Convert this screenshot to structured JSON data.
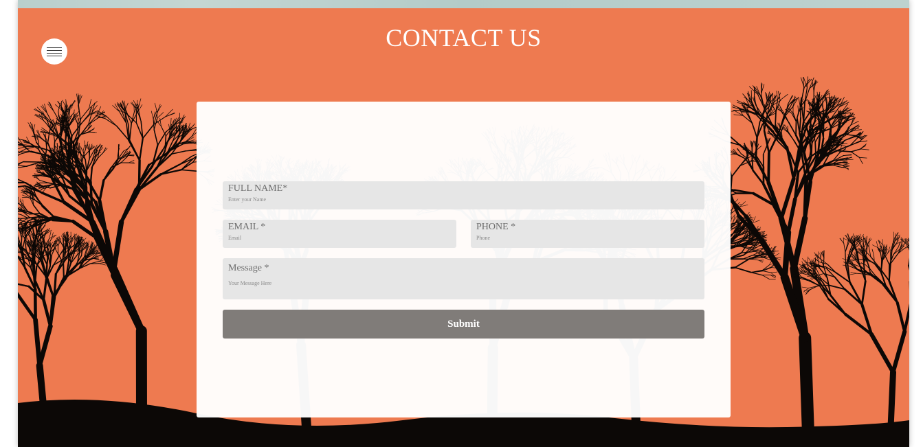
{
  "page": {
    "title": "CONTACT US"
  },
  "menu": {
    "icon": "hamburger-icon"
  },
  "form": {
    "full_name": {
      "label": "FULL NAME*",
      "placeholder": "Enter your Name",
      "value": ""
    },
    "email": {
      "label": "EMAIL *",
      "placeholder": "Email",
      "value": ""
    },
    "phone": {
      "label": "PHONE *",
      "placeholder": "Phone",
      "value": ""
    },
    "message": {
      "label": "Message *",
      "placeholder": "Your Message Here",
      "value": ""
    },
    "submit_label": "Submit"
  },
  "colors": {
    "hero_background": "#ee7a50",
    "tree_silhouette": "#0c0806",
    "field_background": "#e6e6e6",
    "submit_background": "#807c79"
  }
}
